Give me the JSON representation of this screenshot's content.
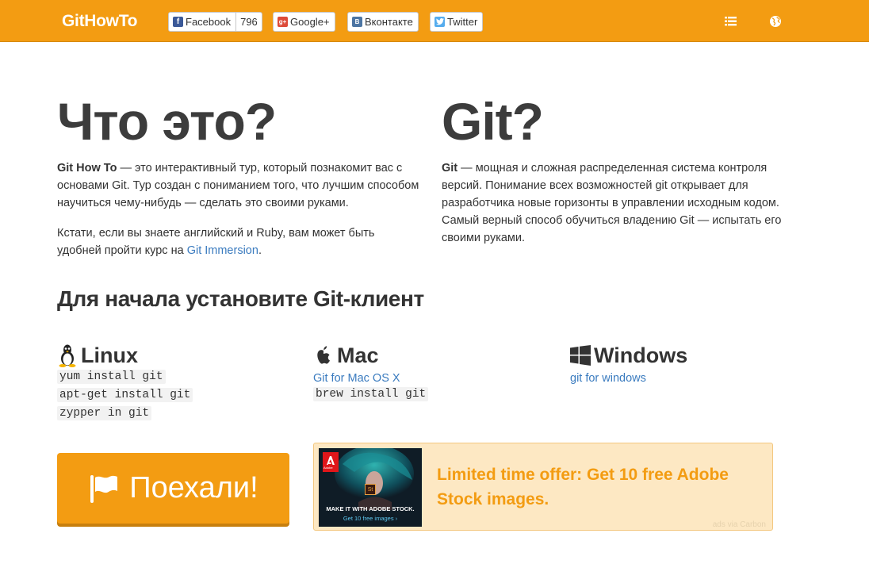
{
  "header": {
    "brand": "GitHowTo",
    "share": {
      "facebook": {
        "label": "Facebook",
        "count": "796"
      },
      "google": {
        "label": "Google+"
      },
      "vk": {
        "label": "Вконтакте"
      },
      "twitter": {
        "label": "Twitter"
      }
    },
    "icons": [
      "list-icon",
      "globe-icon"
    ]
  },
  "intro": {
    "what_title": "Что это?",
    "what_p1_bold": "Git How To",
    "what_p1_rest": " — это интерактивный тур, который познакомит вас с основами Git. Тур создан с пониманием того, что лучшим способом научиться чему-нибудь — сделать это своими руками.",
    "what_p2_text": "Кстати, если вы знаете английский и Ruby, вам может быть удобней пройти курс на ",
    "what_p2_link": "Git Immersion",
    "what_p2_end": ".",
    "git_title": "Git?",
    "git_p_bold": "Git",
    "git_p_rest": " — мощная и сложная распределенная система контроля версий. Понимание всех возможностей git открывает для разработчика новые горизонты в управлении исходным кодом. Самый верный способ обучиться владению Git — испытать его своими руками."
  },
  "install": {
    "title": "Для начала установите Git-клиент",
    "linux": {
      "name": "Linux",
      "commands": [
        "yum install git",
        "apt-get install git",
        "zypper in git"
      ]
    },
    "mac": {
      "name": "Mac",
      "link": "Git for Mac OS X",
      "command": "brew install git"
    },
    "windows": {
      "name": "Windows",
      "link": "git for windows"
    }
  },
  "start_button": "Поехали!",
  "ad": {
    "brand": "Adobe",
    "badge": "St",
    "image_line1": "MAKE IT WITH ADOBE STOCK.",
    "image_line2": "Get 10 free images ›",
    "text": "Limited time offer: Get 10 free Adobe Stock images.",
    "via": "ads via Carbon"
  },
  "colors": {
    "accent": "#f39c12",
    "link": "#3a7bbf"
  }
}
